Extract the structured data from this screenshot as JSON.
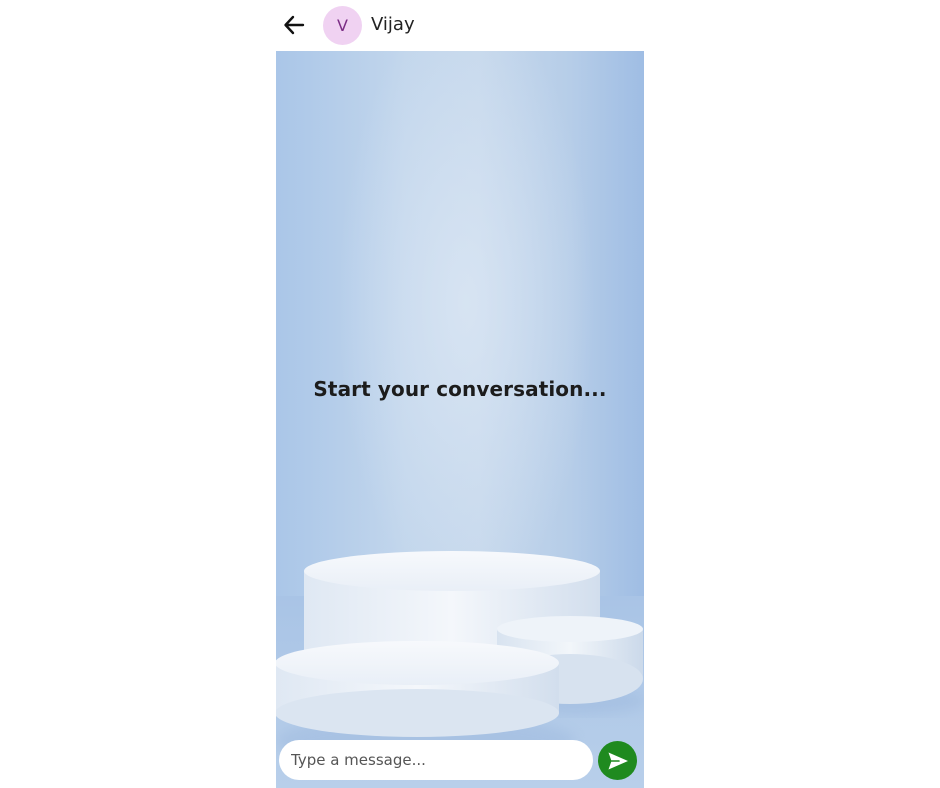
{
  "header": {
    "back_icon": "arrow-left-icon",
    "avatar_initial": "V",
    "contact_name": "Vijay"
  },
  "chat": {
    "empty_state_text": "Start your conversation..."
  },
  "composer": {
    "placeholder": "Type a message...",
    "value": "",
    "send_icon": "send-icon"
  },
  "colors": {
    "avatar_bg": "#f0d2f2",
    "avatar_text": "#7b2d85",
    "send_button": "#1f8a1f",
    "chat_bg": "#bcd1ea"
  }
}
